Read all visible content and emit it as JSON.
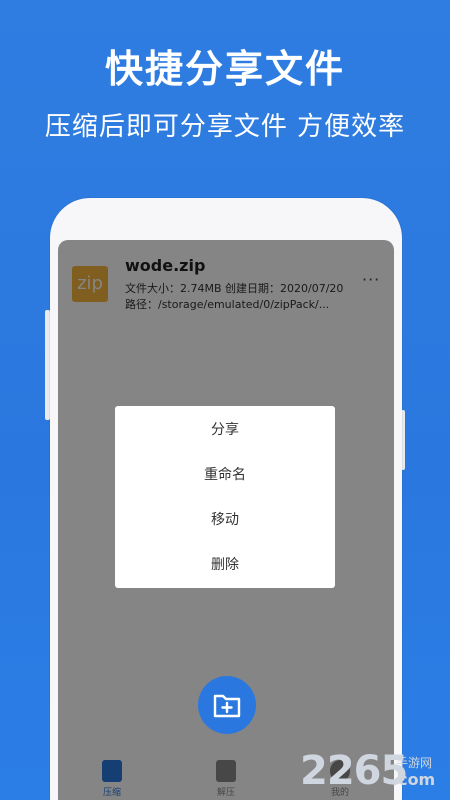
{
  "promo": {
    "headline": "快捷分享文件",
    "subline": "压缩后即可分享文件 方便效率"
  },
  "file": {
    "icon_label": "zip",
    "name": "wode.zip",
    "meta": "文件大小：2.74MB  创建日期：2020/07/20",
    "path": "路径：/storage/emulated/0/zipPack/...",
    "more_icon": "more-horizontal-icon",
    "more_label": "···"
  },
  "context_menu": {
    "items": [
      "分享",
      "重命名",
      "移动",
      "删除"
    ]
  },
  "fab": {
    "icon": "folder-add-icon"
  },
  "tabs": [
    {
      "label": "压缩",
      "icon": "zip-file-icon"
    },
    {
      "label": "解压",
      "icon": "folder-icon"
    },
    {
      "label": "我的",
      "icon": "user-icon"
    }
  ],
  "watermark": {
    "number": "2265",
    "line1": "手游网",
    "line2": ".com"
  },
  "colors": {
    "brand": "#2a78df",
    "zip_icon": "#f4b53c"
  }
}
